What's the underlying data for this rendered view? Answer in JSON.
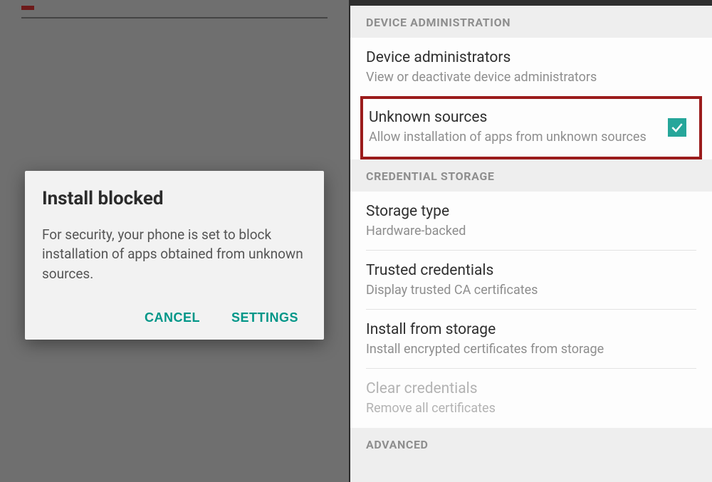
{
  "dialog": {
    "title": "Install blocked",
    "body": "For security, your phone is set to block installation of apps obtained from unknown sources.",
    "cancel": "CANCEL",
    "settings": "SETTINGS"
  },
  "sections": {
    "deviceAdmin": {
      "header": "DEVICE ADMINISTRATION",
      "items": {
        "admins": {
          "title": "Device administrators",
          "sub": "View or deactivate device administrators"
        },
        "unknown": {
          "title": "Unknown sources",
          "sub": "Allow installation of apps from unknown sources",
          "checked": true
        }
      }
    },
    "credStorage": {
      "header": "CREDENTIAL STORAGE",
      "items": {
        "storageType": {
          "title": "Storage type",
          "sub": "Hardware-backed"
        },
        "trusted": {
          "title": "Trusted credentials",
          "sub": "Display trusted CA certificates"
        },
        "installFrom": {
          "title": "Install from storage",
          "sub": "Install encrypted certificates from storage"
        },
        "clear": {
          "title": "Clear credentials",
          "sub": "Remove all certificates"
        }
      }
    },
    "advanced": {
      "header": "ADVANCED"
    }
  }
}
